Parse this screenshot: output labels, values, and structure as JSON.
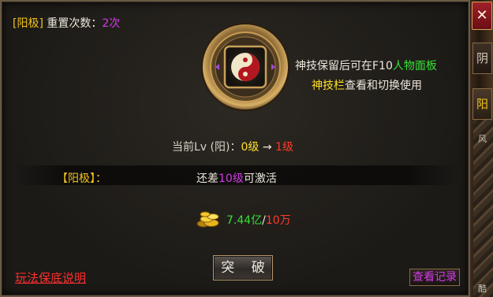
{
  "header": {
    "tag": "[阳极]",
    "reset_label": "重置次数：",
    "reset_count": "2次"
  },
  "description": {
    "line1_prefix": "神技保留后可在F10",
    "line1_highlight": "人物面板",
    "line2_highlight": "神技栏",
    "line2_suffix": "查看和切换使用"
  },
  "level": {
    "prefix": "当前Lv (阳)：",
    "current": "0级",
    "arrow": "→",
    "next": "1级"
  },
  "activation": {
    "label": "【阳极】：",
    "text_prefix": "还差",
    "needed": "10级",
    "text_suffix": "可激活"
  },
  "cost": {
    "have": "7.44亿",
    "separator": "/",
    "need": "10万",
    "icon": "gold-coins-icon"
  },
  "buttons": {
    "break": "突 破",
    "rules": "玩法保底说明",
    "records": "查看记录",
    "close": "✕"
  },
  "side": {
    "tab_yin": "阴",
    "tab_yang": "阳",
    "text1": "风",
    "text2": "酷"
  },
  "colors": {
    "accent_gold": "#f1c21c",
    "purple": "#d23ce8",
    "green": "#35e035",
    "red": "#ff3b2a",
    "yellow": "#ffe02a"
  }
}
